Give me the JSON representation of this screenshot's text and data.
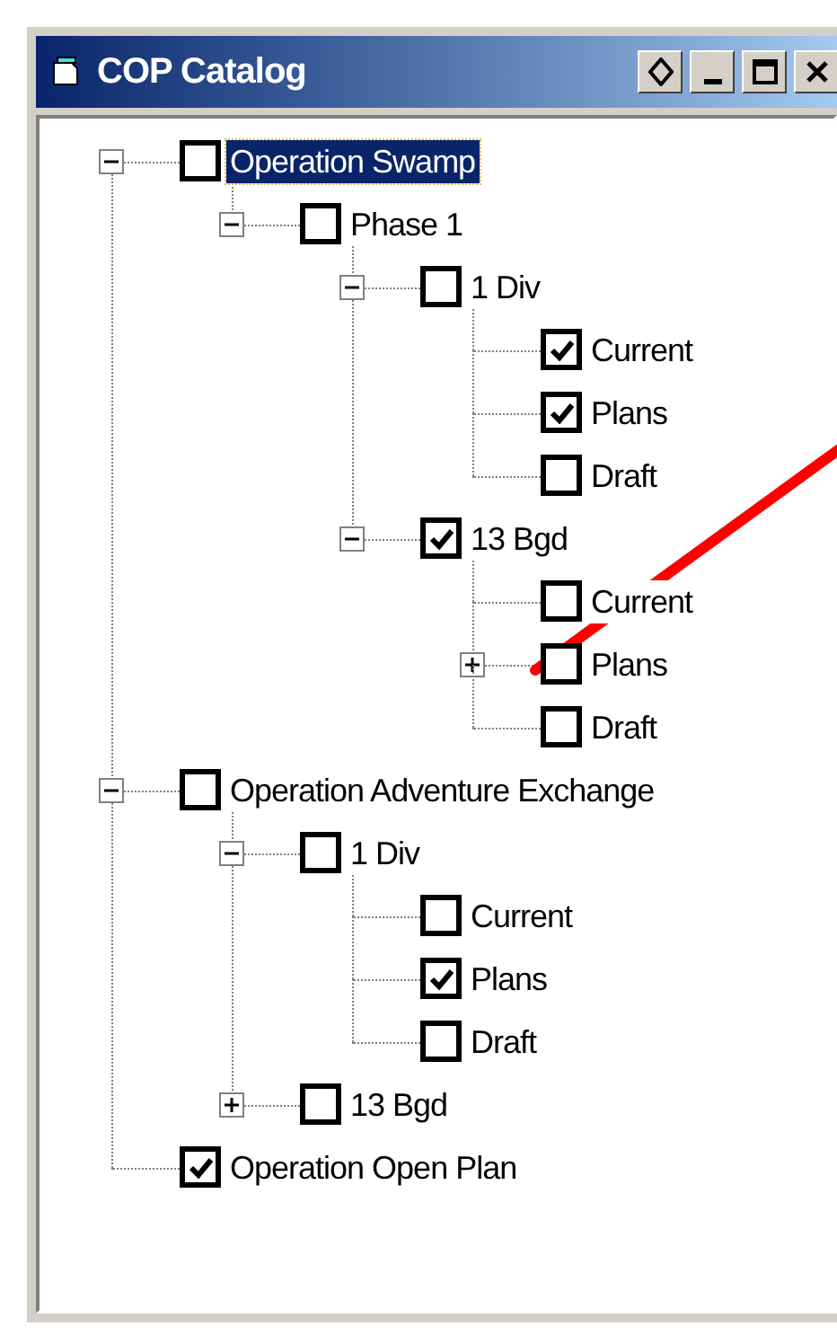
{
  "window": {
    "title": "COP Catalog"
  },
  "tree": [
    {
      "label": "Operation Swamp",
      "checked": false,
      "expanded": true,
      "selected": true,
      "children": [
        {
          "label": "Phase 1",
          "checked": false,
          "expanded": true,
          "selected": false,
          "children": [
            {
              "label": "1 Div",
              "checked": false,
              "expanded": true,
              "selected": false,
              "children": [
                {
                  "label": "Current",
                  "checked": true,
                  "selected": false
                },
                {
                  "label": "Plans",
                  "checked": true,
                  "selected": false
                },
                {
                  "label": "Draft",
                  "checked": false,
                  "selected": false
                }
              ]
            },
            {
              "label": "13 Bgd",
              "checked": true,
              "expanded": true,
              "selected": false,
              "children": [
                {
                  "label": "Current",
                  "checked": false,
                  "selected": false
                },
                {
                  "label": "Plans",
                  "checked": false,
                  "expanded": false,
                  "selected": false
                },
                {
                  "label": "Draft",
                  "checked": false,
                  "selected": false
                }
              ]
            }
          ]
        }
      ]
    },
    {
      "label": "Operation Adventure Exchange",
      "checked": false,
      "expanded": true,
      "selected": false,
      "children": [
        {
          "label": "1 Div",
          "checked": false,
          "expanded": true,
          "selected": false,
          "children": [
            {
              "label": "Current",
              "checked": false,
              "selected": false
            },
            {
              "label": "Plans",
              "checked": true,
              "selected": false
            },
            {
              "label": "Draft",
              "checked": false,
              "selected": false
            }
          ]
        },
        {
          "label": "13 Bgd",
          "checked": false,
          "expanded": false,
          "selected": false
        }
      ]
    },
    {
      "label": "Operation Open Plan",
      "checked": true,
      "selected": false
    }
  ]
}
